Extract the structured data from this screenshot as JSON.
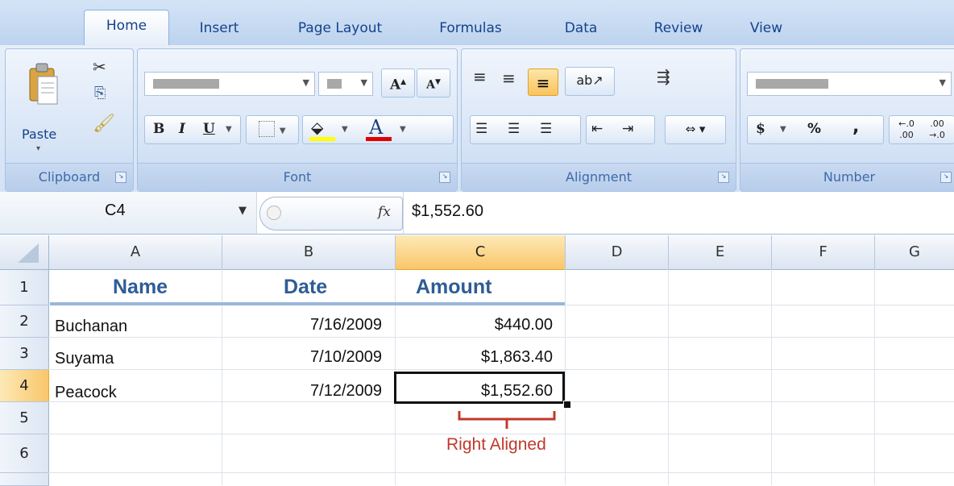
{
  "tabs": [
    "Home",
    "Insert",
    "Page Layout",
    "Formulas",
    "Data",
    "Review",
    "View"
  ],
  "groups": {
    "clipboard": {
      "label": "Clipboard",
      "paste_label": "Paste"
    },
    "font": {
      "label": "Font",
      "bold": "B",
      "italic": "I",
      "underline": "U",
      "grow": "A",
      "shrink": "A",
      "font_color": "A"
    },
    "alignment": {
      "label": "Alignment"
    },
    "number": {
      "label": "Number",
      "currency": "$",
      "percent": "%",
      "comma": ",",
      "inc_decimal": ".0 .00",
      "dec_decimal": ".00 .0"
    }
  },
  "formula_bar": {
    "name_box": "C4",
    "fx": "fx",
    "formula": "$1,552.60"
  },
  "columns": [
    "A",
    "B",
    "C",
    "D",
    "E",
    "F",
    "G"
  ],
  "rows": [
    "1",
    "2",
    "3",
    "4",
    "5",
    "6"
  ],
  "header_row": {
    "a": "Name",
    "b": "Date",
    "c": "Amount"
  },
  "data_rows": [
    {
      "a": "Buchanan",
      "b": "7/16/2009",
      "c": "$440.00"
    },
    {
      "a": "Suyama",
      "b": "7/10/2009",
      "c": "$1,863.40"
    },
    {
      "a": "Peacock",
      "b": "7/12/2009",
      "c": "$1,552.60"
    }
  ],
  "annotation": {
    "text": "Right Aligned",
    "color": "#c0392b"
  },
  "colors": {
    "header_text": "#2e5c96",
    "ribbon_text": "#15428b",
    "selected_header": "#f9c66a",
    "accent_line": "#9ab7dd"
  }
}
